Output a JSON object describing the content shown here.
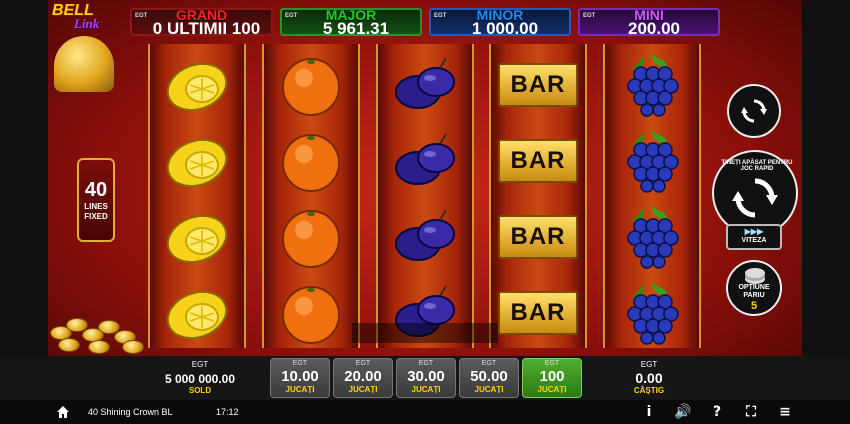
{
  "logo": {
    "line1": "BELL",
    "line2": "Link"
  },
  "jackpots": [
    {
      "key": "grand",
      "name": "GRAND",
      "tag": "EGT",
      "value": "0 ULTIMII 100"
    },
    {
      "key": "major",
      "name": "MAJOR",
      "tag": "EGT",
      "value": "5 961.31"
    },
    {
      "key": "minor",
      "name": "MINOR",
      "tag": "EGT",
      "value": "1 000.00"
    },
    {
      "key": "mini",
      "name": "MINI",
      "tag": "EGT",
      "value": "200.00"
    }
  ],
  "lines": {
    "count": "40",
    "label1": "LINES",
    "label2": "FIXED"
  },
  "reels": [
    [
      "lemon",
      "lemon",
      "lemon",
      "lemon"
    ],
    [
      "orange",
      "orange",
      "orange",
      "orange"
    ],
    [
      "plum",
      "plum",
      "plum",
      "plum"
    ],
    [
      "bar",
      "bar",
      "bar",
      "bar"
    ],
    [
      "grapes",
      "grapes",
      "grapes",
      "grapes"
    ]
  ],
  "bar_text": "BAR",
  "controls": {
    "autoplay_icon": "autoplay-icon",
    "spin_hint": "ȚINEȚI APĂSAT PENTRU JOC RAPID",
    "speed_arrows": "▶▶▶",
    "speed_label": "VITEZA",
    "bet_option_label1": "OPȚIUNE",
    "bet_option_label2": "PARIU",
    "bet_option_value": "5"
  },
  "credit": {
    "tag": "EGT",
    "amount": "5 000 000.00",
    "label": "SOLD"
  },
  "bets": [
    {
      "tag": "EGT",
      "value": "10.00",
      "label": "JUCAȚI",
      "selected": false
    },
    {
      "tag": "EGT",
      "value": "20.00",
      "label": "JUCAȚI",
      "selected": false
    },
    {
      "tag": "EGT",
      "value": "30.00",
      "label": "JUCAȚI",
      "selected": false
    },
    {
      "tag": "EGT",
      "value": "50.00",
      "label": "JUCAȚI",
      "selected": false
    },
    {
      "tag": "EGT",
      "value": "100",
      "label": "JUCAȚI",
      "selected": true
    }
  ],
  "win": {
    "tag": "EGT",
    "amount": "0.00",
    "label": "CÂȘTIG"
  },
  "status": {
    "game_name": "40 Shining Crown BL",
    "time": "17:12",
    "icons": [
      "info-icon",
      "sound-icon",
      "help-icon",
      "fullscreen-icon",
      "menu-icon"
    ],
    "icon_glyphs": [
      "i",
      "🔊",
      "?",
      "⛶",
      "≡"
    ]
  }
}
